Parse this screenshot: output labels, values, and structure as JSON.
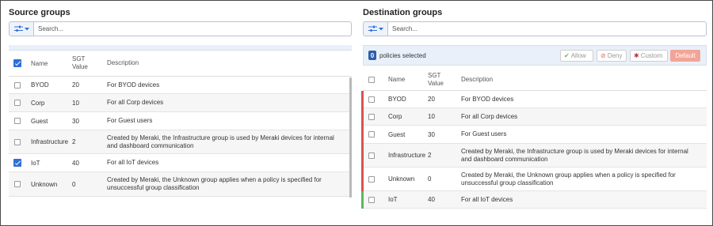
{
  "source": {
    "title": "Source groups",
    "search_placeholder": "Search...",
    "columns": {
      "name": "Name",
      "sgt": "SGT Value",
      "sgt_l1": "SGT",
      "sgt_l2": "Value",
      "desc": "Description"
    },
    "header_checked": true,
    "rows": [
      {
        "name": "BYOD",
        "sgt": "20",
        "desc": "For BYOD devices",
        "checked": false
      },
      {
        "name": "Corp",
        "sgt": "10",
        "desc": "For all Corp devices",
        "checked": false
      },
      {
        "name": "Guest",
        "sgt": "30",
        "desc": "For Guest users",
        "checked": false
      },
      {
        "name": "Infrastructure",
        "sgt": "2",
        "desc_l1": "Created by Meraki, the Infrastructure group is used by Meraki devices for internal",
        "desc_l2": "and dashboard communication",
        "checked": false
      },
      {
        "name": "IoT",
        "sgt": "40",
        "desc": "For all IoT devices",
        "checked": true
      },
      {
        "name": "Unknown",
        "sgt": "0",
        "desc_l1": "Created by Meraki, the Unknown group applies when a policy is specified for",
        "desc_l2": "unsuccessful group classification",
        "checked": false
      }
    ]
  },
  "destination": {
    "title": "Destination groups",
    "search_placeholder": "Search...",
    "selected_count": "0",
    "selected_text": "policies selected",
    "buttons": {
      "allow": "Allow",
      "deny": "Deny",
      "custom": "Custom",
      "default": "Default"
    },
    "columns": {
      "name": "Name",
      "sgt_l1": "SGT",
      "sgt_l2": "Value",
      "desc": "Description"
    },
    "colors": {
      "deny_bar": "#d9534f",
      "allow_bar": "#5cb85c",
      "default_button": "#f2a596"
    },
    "rows": [
      {
        "name": "BYOD",
        "sgt": "20",
        "desc": "For BYOD devices",
        "policy": "deny"
      },
      {
        "name": "Corp",
        "sgt": "10",
        "desc": "For all Corp devices",
        "policy": "deny"
      },
      {
        "name": "Guest",
        "sgt": "30",
        "desc": "For Guest users",
        "policy": "deny"
      },
      {
        "name": "Infrastructure",
        "sgt": "2",
        "desc_l1": "Created by Meraki, the Infrastructure group is used by Meraki devices for internal",
        "desc_l2": "and dashboard communication",
        "policy": "deny"
      },
      {
        "name": "Unknown",
        "sgt": "0",
        "desc_l1": "Created by Meraki, the Unknown group applies when a policy is specified for",
        "desc_l2": "unsuccessful group classification",
        "policy": "deny"
      },
      {
        "name": "IoT",
        "sgt": "40",
        "desc": "For all IoT devices",
        "policy": "allow"
      }
    ]
  }
}
